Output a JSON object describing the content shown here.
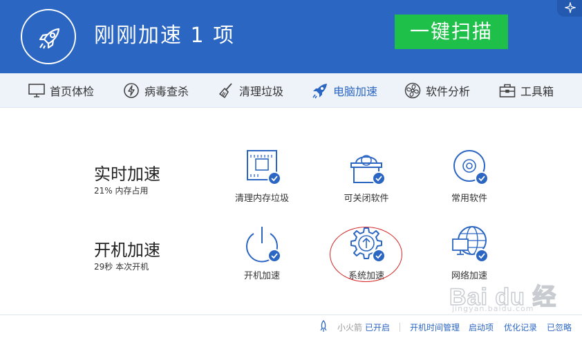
{
  "header": {
    "title": "刚刚加速 1 项",
    "scan_button": "一键扫描",
    "bg_color": "#2b66c3",
    "button_color": "#1ec04a"
  },
  "nav": {
    "items": [
      {
        "label": "首页体检",
        "icon": "monitor-icon"
      },
      {
        "label": "病毒查杀",
        "icon": "lightning-shield-icon"
      },
      {
        "label": "清理垃圾",
        "icon": "broom-icon"
      },
      {
        "label": "电脑加速",
        "icon": "rocket-icon",
        "active": true
      },
      {
        "label": "软件分析",
        "icon": "fan-icon"
      },
      {
        "label": "工具箱",
        "icon": "toolbox-icon"
      }
    ]
  },
  "rows": [
    {
      "title": "实时加速",
      "subtitle": "21% 内存占用",
      "tiles": [
        {
          "label": "清理内存垃圾",
          "icon": "memory-chip-icon",
          "checked": true
        },
        {
          "label": "可关闭软件",
          "icon": "software-box-icon",
          "checked": true
        },
        {
          "label": "常用软件",
          "icon": "disc-icon",
          "checked": true
        }
      ]
    },
    {
      "title": "开机加速",
      "subtitle": "29秒 本次开机",
      "tiles": [
        {
          "label": "开机加速",
          "icon": "power-icon",
          "checked": true
        },
        {
          "label": "系统加速",
          "icon": "gear-arrow-icon",
          "checked": true,
          "highlighted": true
        },
        {
          "label": "网络加速",
          "icon": "globe-monitor-icon",
          "checked": true
        }
      ]
    }
  ],
  "footer": {
    "rocket_label": "小火箭",
    "rocket_status": "已开启",
    "links": [
      "开机时间管理",
      "启动项",
      "优化记录",
      "已忽略"
    ]
  },
  "watermark": {
    "main": "Bai du 经验",
    "sub": "jingyan.baidu.com"
  }
}
